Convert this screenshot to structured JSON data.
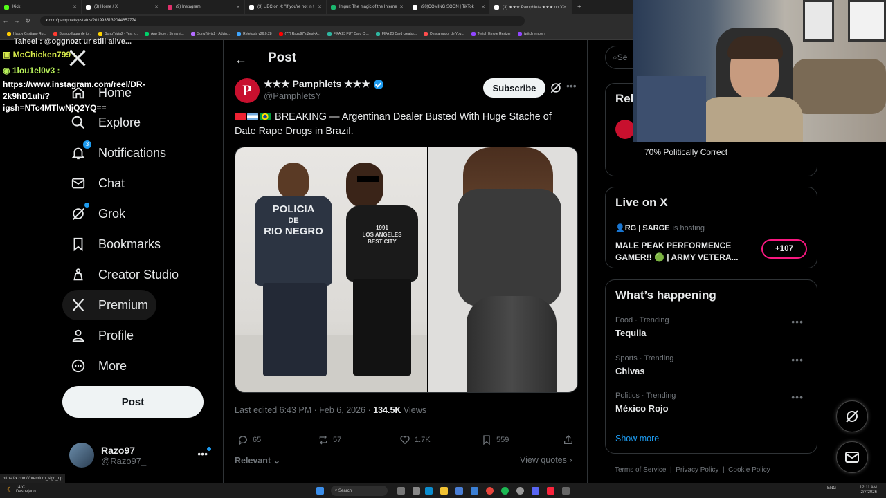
{
  "browser": {
    "tabs": [
      {
        "title": "Kick",
        "color": "#53fc18"
      },
      {
        "title": "(3) Home / X",
        "color": "#ffffff"
      },
      {
        "title": "(9) Instagram",
        "color": "#e1306c"
      },
      {
        "title": "(3) UBC on X: \"If you're not in t",
        "color": "#ffffff"
      },
      {
        "title": "Imgur: The magic of the Interne",
        "color": "#1bb76e"
      },
      {
        "title": "(90)COMING SOON | TikTok",
        "color": "#ffffff"
      },
      {
        "title": "(3) ★★★ Pamphlets ★★★ on X",
        "color": "#ffffff"
      }
    ],
    "url": "x.com/pamphletsy/status/2019935132044652774",
    "bookmarks": [
      {
        "label": "Happy Cristiano Ro...",
        "color": "#ffcc00"
      },
      {
        "label": "Burago figura de to...",
        "color": "#ff3b30"
      },
      {
        "label": "SongTrivia2 - Test y...",
        "color": "#ffd400"
      },
      {
        "label": "App Store / Streami...",
        "color": "#00d26a"
      },
      {
        "label": "SongTrivia2 - Advin...",
        "color": "#b36bff"
      },
      {
        "label": "Reletools v26.0.28",
        "color": "#3ea6ff"
      },
      {
        "label": "(77) Razo97's Zest-A...",
        "color": "#ff0000"
      },
      {
        "label": "FIFA 23 FUT Card Cr...",
        "color": "#2fb5a0"
      },
      {
        "label": "FIFA 23 Card creator...",
        "color": "#2fb5a0"
      },
      {
        "label": "Descargador de You...",
        "color": "#ff4d4d"
      },
      {
        "label": "Twitch Emote Resizer",
        "color": "#9146ff"
      },
      {
        "label": "twitch emote r",
        "color": "#9146ff"
      }
    ]
  },
  "chat": {
    "line0": "Taheel : @oggnozt ur still alive...",
    "line1": "McChicken799 :",
    "line2": "1lou1el0v3 :",
    "line3": "https://www.instagram.com/reel/DR-2k9hD1uh/?igsh=NTc4MTlwNjQ2YQ=="
  },
  "nav": {
    "items": [
      {
        "label": "Home"
      },
      {
        "label": "Explore"
      },
      {
        "label": "Notifications",
        "badge": "3"
      },
      {
        "label": "Chat"
      },
      {
        "label": "Grok"
      },
      {
        "label": "Bookmarks"
      },
      {
        "label": "Creator Studio"
      },
      {
        "label": "Premium"
      },
      {
        "label": "Profile"
      },
      {
        "label": "More"
      }
    ],
    "post_label": "Post",
    "account": {
      "name": "Razo97",
      "handle": "@Razo97_"
    }
  },
  "main": {
    "header_title": "Post",
    "author": {
      "name": "★★★ Pamphlets ★★★",
      "handle": "@PamphletsY",
      "avatar_letter": "P"
    },
    "subscribe_label": "Subscribe",
    "text": "BREAKING — Argentinan Dealer Busted With Huge Stache of Date Rape Drugs in Brazil.",
    "image_text": {
      "vest_top": "POLICIA",
      "vest_mid": "DE",
      "vest_bottom": "RIO NEGRO",
      "shirt_top": "1991",
      "shirt_mid": "LOS ANGELES",
      "shirt_bottom": "BEST CITY"
    },
    "meta": {
      "edited": "Last edited 6:43 PM · Feb 6, 2026 · ",
      "views": "134.5K",
      "views_label": " Views"
    },
    "actions": {
      "replies": "65",
      "reposts": "57",
      "likes": "1.7K",
      "bookmarks": "559"
    },
    "relevant_label": "Relevant",
    "view_quotes_label": "View quotes"
  },
  "right": {
    "search_placeholder": "Se",
    "relevant_heading": "Rel",
    "relevant_text": "70% Politically Correct",
    "live": {
      "heading": "Live on X",
      "host": "RG | SARGE",
      "hosting": "is hosting",
      "title": "MALE PEAK PERFORMENCE GAMER!! 🟢 | ARMY VETERA...",
      "count": "+107"
    },
    "whats": {
      "heading": "What’s happening",
      "trends": [
        {
          "category": "Food · Trending",
          "name": "Tequila"
        },
        {
          "category": "Sports · Trending",
          "name": "Chivas"
        },
        {
          "category": "Politics · Trending",
          "name": "México Rojo"
        }
      ],
      "show_more": "Show more"
    },
    "footer": [
      "Terms of Service",
      "Privacy Policy",
      "Cookie Policy"
    ]
  },
  "status_url": "https://x.com/i/premium_sign_up",
  "taskbar": {
    "weather_temp": "14°C",
    "weather_desc": "Despejado",
    "search": "Search",
    "lang": "ENG",
    "time": "12:11 AM",
    "date": "2/7/2026"
  }
}
